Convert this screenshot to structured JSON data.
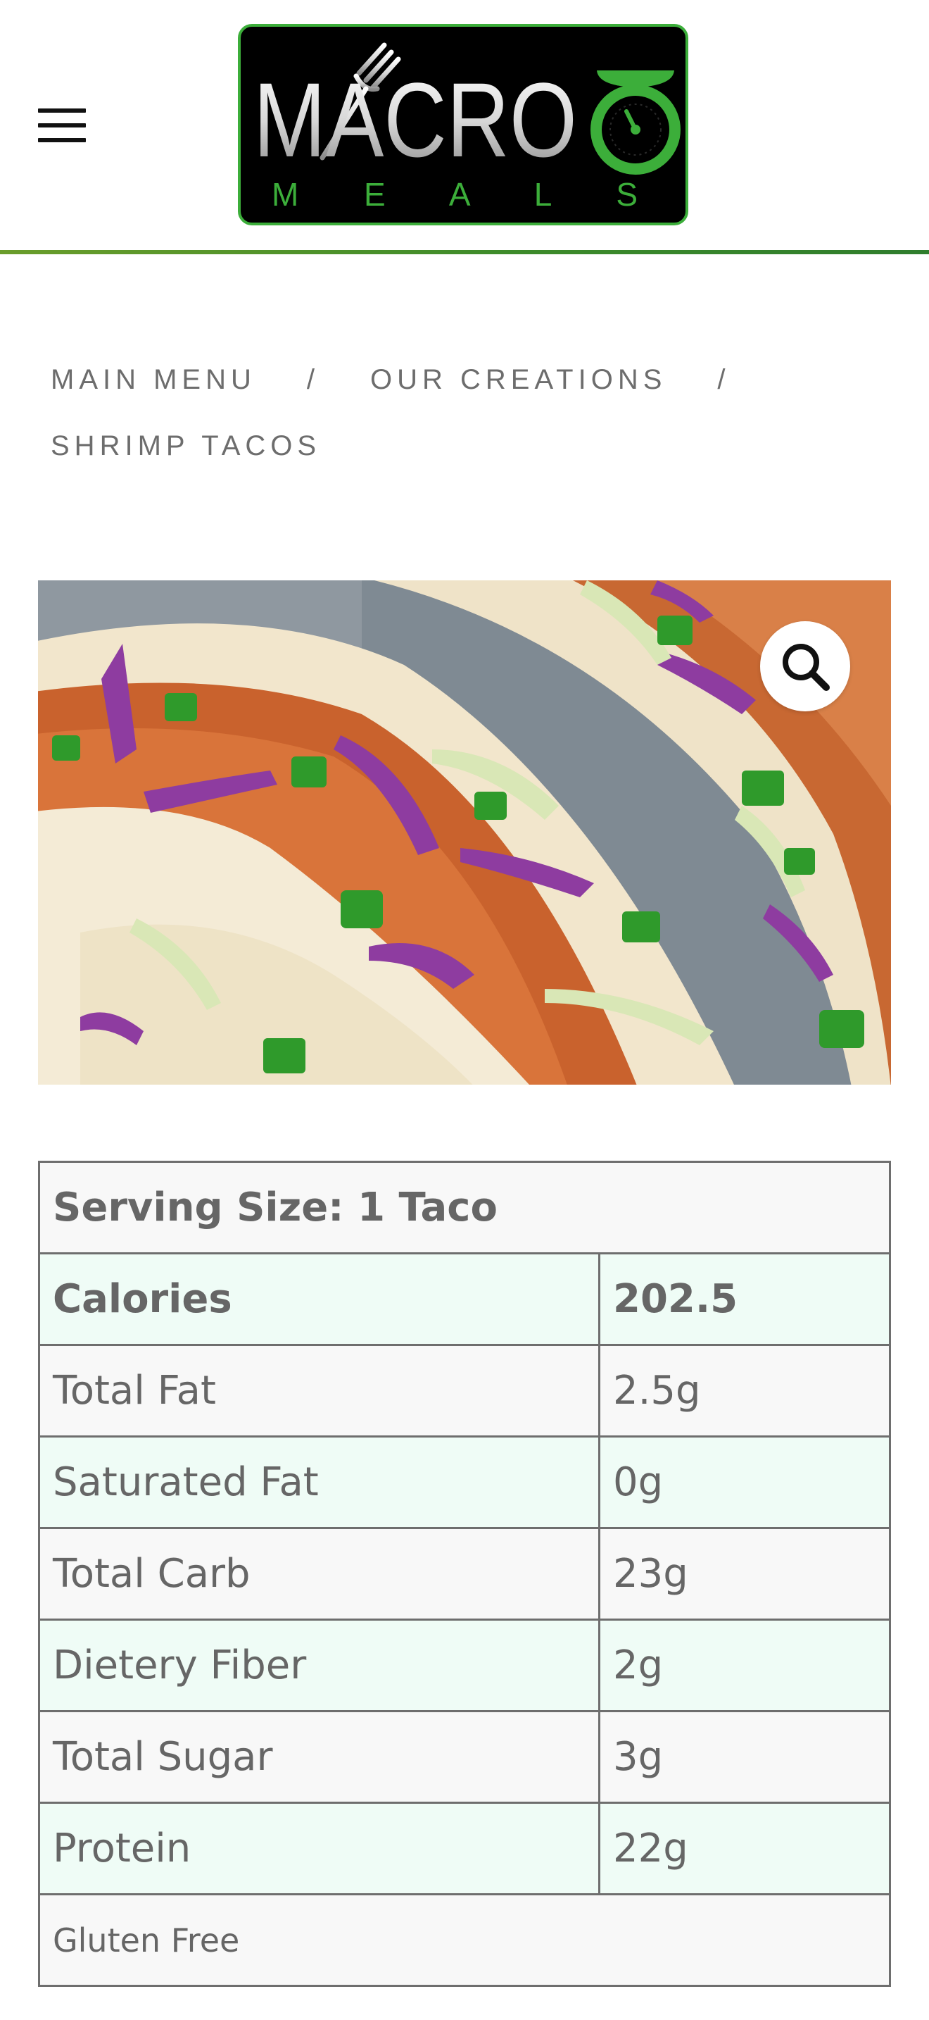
{
  "brand": {
    "logo_word": "MACRO",
    "logo_sub": "M E A L S",
    "colors": {
      "green": "#3cae3a",
      "rule": "#3d8b2a",
      "mint_row": "#effcf6",
      "grey_row": "#f8f8f8"
    }
  },
  "header": {
    "menu_icon": "hamburger-menu-icon"
  },
  "breadcrumb": {
    "items": [
      "MAIN MENU",
      "OUR CREATIONS"
    ],
    "separator": "/",
    "current": "SHRIMP TACOS"
  },
  "product": {
    "image_alt": "Shrimp tacos with cabbage and peppers",
    "zoom_icon": "magnifier-icon"
  },
  "nutrition": {
    "serving": "Serving Size: 1 Taco",
    "rows": [
      {
        "label": "Calories",
        "value": "202.5"
      },
      {
        "label": "Total Fat",
        "value": "2.5g"
      },
      {
        "label": "Saturated Fat",
        "value": "0g"
      },
      {
        "label": "Total Carb",
        "value": "23g"
      },
      {
        "label": "Dietery Fiber",
        "value": "2g"
      },
      {
        "label": "Total Sugar",
        "value": "3g"
      },
      {
        "label": "Protein",
        "value": "22g"
      }
    ],
    "note": "Gluten Free"
  }
}
